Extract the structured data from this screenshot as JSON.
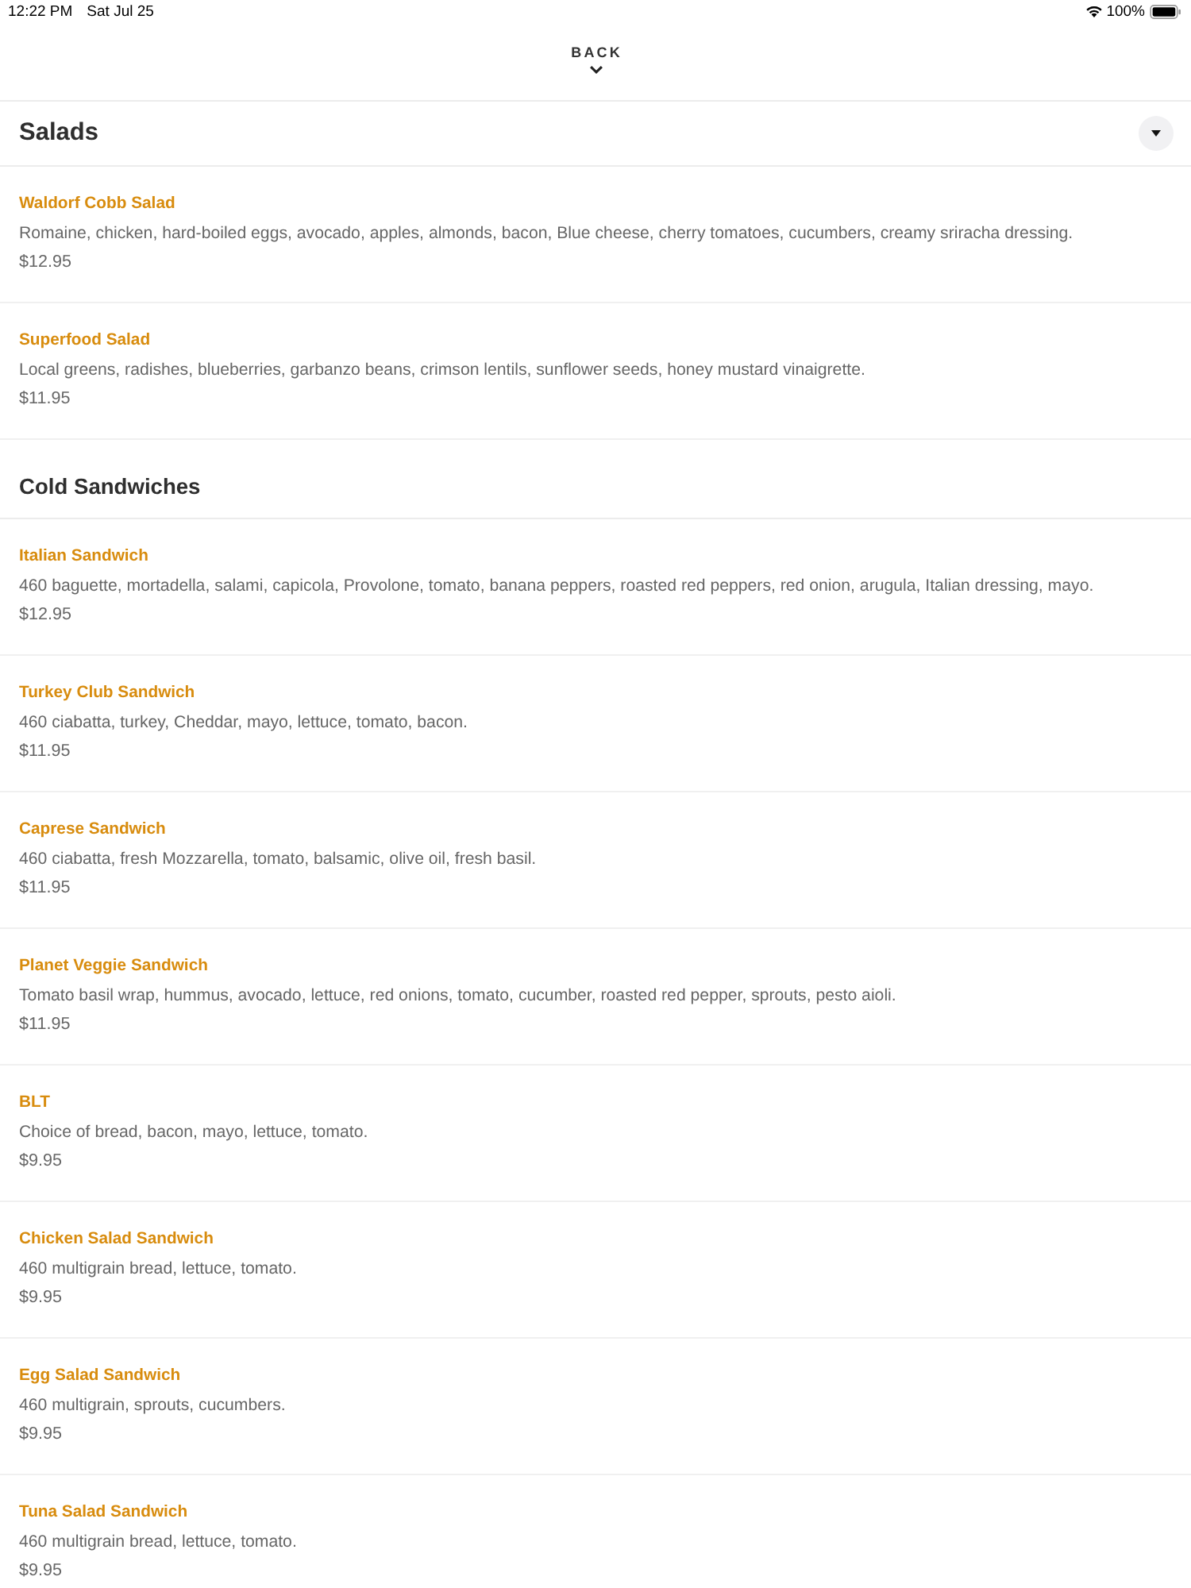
{
  "status_bar": {
    "time": "12:22 PM",
    "date": "Sat Jul 25",
    "battery": "100%"
  },
  "back": {
    "label": "BACK"
  },
  "current_category": {
    "title": "Salads",
    "dropdown": true
  },
  "sections": [
    {
      "items": [
        {
          "name": "Waldorf Cobb Salad",
          "description": "Romaine, chicken, hard-boiled eggs, avocado, apples, almonds, bacon, Blue cheese, cherry tomatoes, cucumbers, creamy sriracha dressing.",
          "price": "$12.95"
        },
        {
          "name": "Superfood Salad",
          "description": "Local greens, radishes, blueberries, garbanzo beans, crimson lentils, sunflower seeds, honey mustard vinaigrette.",
          "price": "$11.95"
        }
      ]
    },
    {
      "title": "Cold Sandwiches",
      "items": [
        {
          "name": "Italian Sandwich",
          "description": "460 baguette, mortadella, salami, capicola, Provolone, tomato, banana peppers, roasted red peppers, red onion, arugula, Italian dressing, mayo.",
          "price": "$12.95"
        },
        {
          "name": "Turkey Club Sandwich",
          "description": "460 ciabatta, turkey, Cheddar, mayo, lettuce, tomato, bacon.",
          "price": "$11.95"
        },
        {
          "name": "Caprese Sandwich",
          "description": "460 ciabatta, fresh Mozzarella, tomato, balsamic, olive oil, fresh basil.",
          "price": "$11.95"
        },
        {
          "name": "Planet Veggie Sandwich",
          "description": "Tomato basil wrap, hummus, avocado, lettuce, red onions, tomato, cucumber, roasted red pepper, sprouts, pesto aioli.",
          "price": "$11.95"
        },
        {
          "name": "BLT",
          "description": "Choice of bread, bacon, mayo, lettuce, tomato.",
          "price": "$9.95"
        },
        {
          "name": "Chicken Salad Sandwich",
          "description": "460 multigrain bread, lettuce, tomato.",
          "price": "$9.95"
        },
        {
          "name": "Egg Salad Sandwich",
          "description": "460 multigrain, sprouts, cucumbers.",
          "price": "$9.95"
        },
        {
          "name": "Tuna Salad Sandwich",
          "description": "460 multigrain bread, lettuce, tomato.",
          "price": "$9.95"
        }
      ]
    }
  ]
}
